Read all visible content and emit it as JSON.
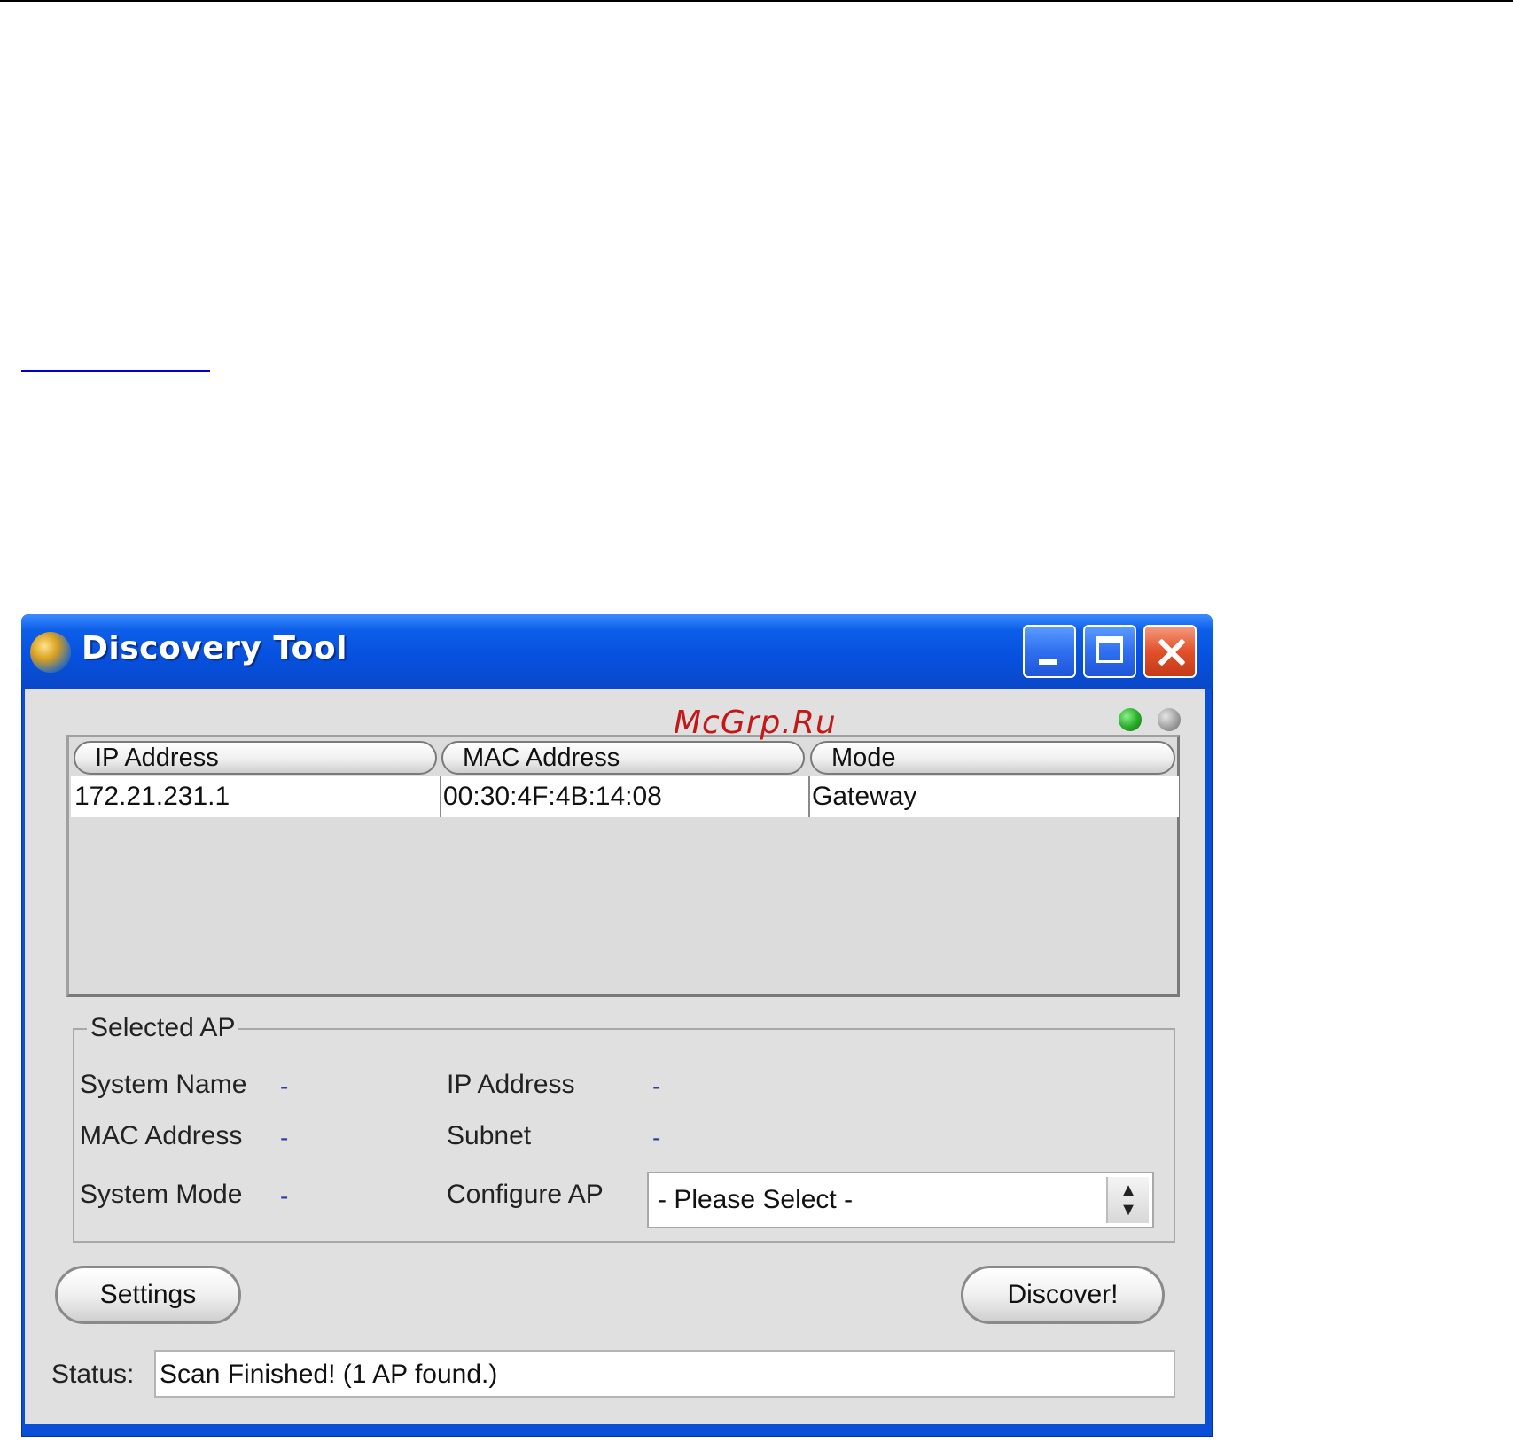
{
  "window": {
    "title": "Discovery Tool",
    "watermark": "McGrp.Ru"
  },
  "table": {
    "columns": [
      "IP Address",
      "MAC Address",
      "Mode"
    ],
    "rows": [
      [
        "172.21.231.1",
        "00:30:4F:4B:14:08",
        "Gateway"
      ]
    ]
  },
  "selected_ap": {
    "title": "Selected AP",
    "system_name_label": "System Name",
    "system_name_value": "-",
    "mac_address_label": "MAC Address",
    "mac_address_value": "-",
    "system_mode_label": "System Mode",
    "system_mode_value": "-",
    "ip_address_label": "IP Address",
    "ip_address_value": "-",
    "subnet_label": "Subnet",
    "subnet_value": "-",
    "configure_ap_label": "Configure AP",
    "configure_ap_selected": "- Please Select -"
  },
  "buttons": {
    "settings": "Settings",
    "discover": "Discover!"
  },
  "status": {
    "label": "Status:",
    "text": "Scan Finished! (1 AP found.)"
  },
  "indicators": {
    "left_color": "#2cb02c",
    "right_color": "#a0a0a0"
  },
  "icons": {
    "app": "globe-icon",
    "minimize": "minimize-icon",
    "maximize": "maximize-icon",
    "close": "close-icon",
    "spinner": "up-down-arrows-icon"
  }
}
